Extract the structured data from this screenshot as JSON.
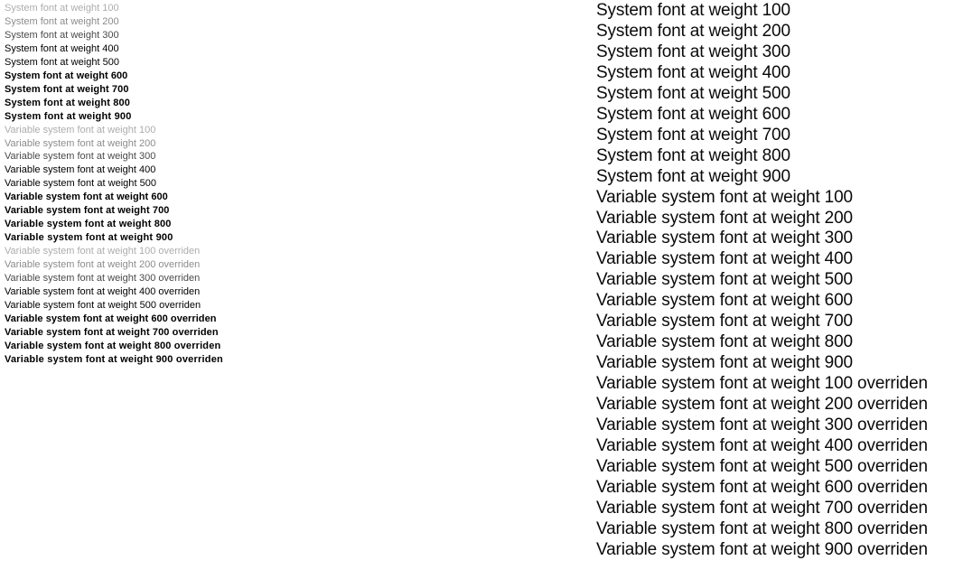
{
  "page": {
    "background_color": "#ffffff",
    "text_color": "#000000",
    "light_text_color": "#adadad"
  },
  "columns": {
    "left": {
      "name": "small-specimen-column",
      "font_size_px": 11,
      "weights_render": true,
      "lines": [
        {
          "text": "System font at weight 100",
          "weight": 100
        },
        {
          "text": "System font at weight 200",
          "weight": 200
        },
        {
          "text": "System font at weight 300",
          "weight": 300
        },
        {
          "text": "System font at weight 400",
          "weight": 400
        },
        {
          "text": "System font at weight 500",
          "weight": 500
        },
        {
          "text": "System font at weight 600",
          "weight": 600
        },
        {
          "text": "System font at weight 700",
          "weight": 700
        },
        {
          "text": "System font at weight 800",
          "weight": 800
        },
        {
          "text": "System font at weight 900",
          "weight": 900
        },
        {
          "text": "Variable system font at weight 100",
          "weight": 100
        },
        {
          "text": "Variable system font at weight 200",
          "weight": 200
        },
        {
          "text": "Variable system font at weight 300",
          "weight": 300
        },
        {
          "text": "Variable system font at weight 400",
          "weight": 400
        },
        {
          "text": "Variable system font at weight 500",
          "weight": 500
        },
        {
          "text": "Variable system font at weight 600",
          "weight": 600
        },
        {
          "text": "Variable system font at weight 700",
          "weight": 700
        },
        {
          "text": "Variable system font at weight 800",
          "weight": 800
        },
        {
          "text": "Variable system font at weight 900",
          "weight": 900
        },
        {
          "text": "Variable system font at weight 100 overriden",
          "weight": 100
        },
        {
          "text": "Variable system font at weight 200 overriden",
          "weight": 200
        },
        {
          "text": "Variable system font at weight 300 overriden",
          "weight": 300
        },
        {
          "text": "Variable system font at weight 400 overriden",
          "weight": 400
        },
        {
          "text": "Variable system font at weight 500 overriden",
          "weight": 500
        },
        {
          "text": "Variable system font at weight 600 overriden",
          "weight": 600
        },
        {
          "text": "Variable system font at weight 700 overriden",
          "weight": 700
        },
        {
          "text": "Variable system font at weight 800 overriden",
          "weight": 800
        },
        {
          "text": "Variable system font at weight 900 overriden",
          "weight": 900
        }
      ]
    },
    "right": {
      "name": "large-specimen-column",
      "font_size_px": 19,
      "weights_render": false,
      "lines": [
        {
          "text": "System font at weight 100",
          "weight": 100
        },
        {
          "text": "System font at weight 200",
          "weight": 200
        },
        {
          "text": "System font at weight 300",
          "weight": 300
        },
        {
          "text": "System font at weight 400",
          "weight": 400
        },
        {
          "text": "System font at weight 500",
          "weight": 500
        },
        {
          "text": "System font at weight 600",
          "weight": 600
        },
        {
          "text": "System font at weight 700",
          "weight": 700
        },
        {
          "text": "System font at weight 800",
          "weight": 800
        },
        {
          "text": "System font at weight 900",
          "weight": 900
        },
        {
          "text": "Variable system font at weight 100",
          "weight": 100
        },
        {
          "text": "Variable system font at weight 200",
          "weight": 200
        },
        {
          "text": "Variable system font at weight 300",
          "weight": 300
        },
        {
          "text": "Variable system font at weight 400",
          "weight": 400
        },
        {
          "text": "Variable system font at weight 500",
          "weight": 500
        },
        {
          "text": "Variable system font at weight 600",
          "weight": 600
        },
        {
          "text": "Variable system font at weight 700",
          "weight": 700
        },
        {
          "text": "Variable system font at weight 800",
          "weight": 800
        },
        {
          "text": "Variable system font at weight 900",
          "weight": 900
        },
        {
          "text": "Variable system font at weight 100 overriden",
          "weight": 100
        },
        {
          "text": "Variable system font at weight 200 overriden",
          "weight": 200
        },
        {
          "text": "Variable system font at weight 300 overriden",
          "weight": 300
        },
        {
          "text": "Variable system font at weight 400 overriden",
          "weight": 400
        },
        {
          "text": "Variable system font at weight 500 overriden",
          "weight": 500
        },
        {
          "text": "Variable system font at weight 600 overriden",
          "weight": 600
        },
        {
          "text": "Variable system font at weight 700 overriden",
          "weight": 700
        },
        {
          "text": "Variable system font at weight 800 overriden",
          "weight": 800
        },
        {
          "text": "Variable system font at weight 900 overriden",
          "weight": 900
        }
      ]
    }
  }
}
